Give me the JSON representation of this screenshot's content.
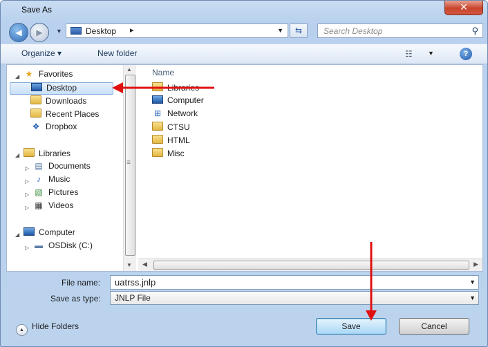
{
  "window": {
    "title": "Save As",
    "close_glyph": "✕"
  },
  "address": {
    "location": "Desktop",
    "separator": "▸",
    "search_placeholder": "Search Desktop"
  },
  "toolbar": {
    "organize": "Organize ▾",
    "new_folder": "New folder"
  },
  "nav": {
    "favorites": {
      "label": "Favorites",
      "icon": "star-icon"
    },
    "favorites_items": [
      {
        "label": "Desktop",
        "icon": "desktop-icon",
        "selected": true
      },
      {
        "label": "Downloads",
        "icon": "downloads-icon"
      },
      {
        "label": "Recent Places",
        "icon": "recent-places-icon"
      },
      {
        "label": "Dropbox",
        "icon": "dropbox-icon"
      }
    ],
    "libraries": {
      "label": "Libraries",
      "icon": "libraries-icon"
    },
    "libraries_items": [
      {
        "label": "Documents",
        "icon": "documents-icon"
      },
      {
        "label": "Music",
        "icon": "music-icon"
      },
      {
        "label": "Pictures",
        "icon": "pictures-icon"
      },
      {
        "label": "Videos",
        "icon": "videos-icon"
      }
    ],
    "computer": {
      "label": "Computer",
      "icon": "computer-icon"
    },
    "computer_items": [
      {
        "label": "OSDisk (C:)",
        "icon": "disk-icon"
      }
    ]
  },
  "files": {
    "column_name": "Name",
    "items": [
      {
        "label": "Libraries",
        "icon": "libraries-icon"
      },
      {
        "label": "Computer",
        "icon": "computer-icon"
      },
      {
        "label": "Network",
        "icon": "network-icon"
      },
      {
        "label": "CTSU",
        "icon": "folder-icon"
      },
      {
        "label": "HTML",
        "icon": "folder-icon"
      },
      {
        "label": "Misc",
        "icon": "folder-icon"
      }
    ]
  },
  "form": {
    "file_name_label": "File name:",
    "file_name_value": "uatrss.jnlp",
    "save_type_label": "Save as type:",
    "save_type_value": "JNLP File"
  },
  "footer": {
    "hide_folders": "Hide Folders",
    "save": "Save",
    "cancel": "Cancel"
  },
  "colors": {
    "annotation_arrow": "#e01010",
    "chrome": "#bcd3ee",
    "accent_blue": "#2a67b6"
  }
}
